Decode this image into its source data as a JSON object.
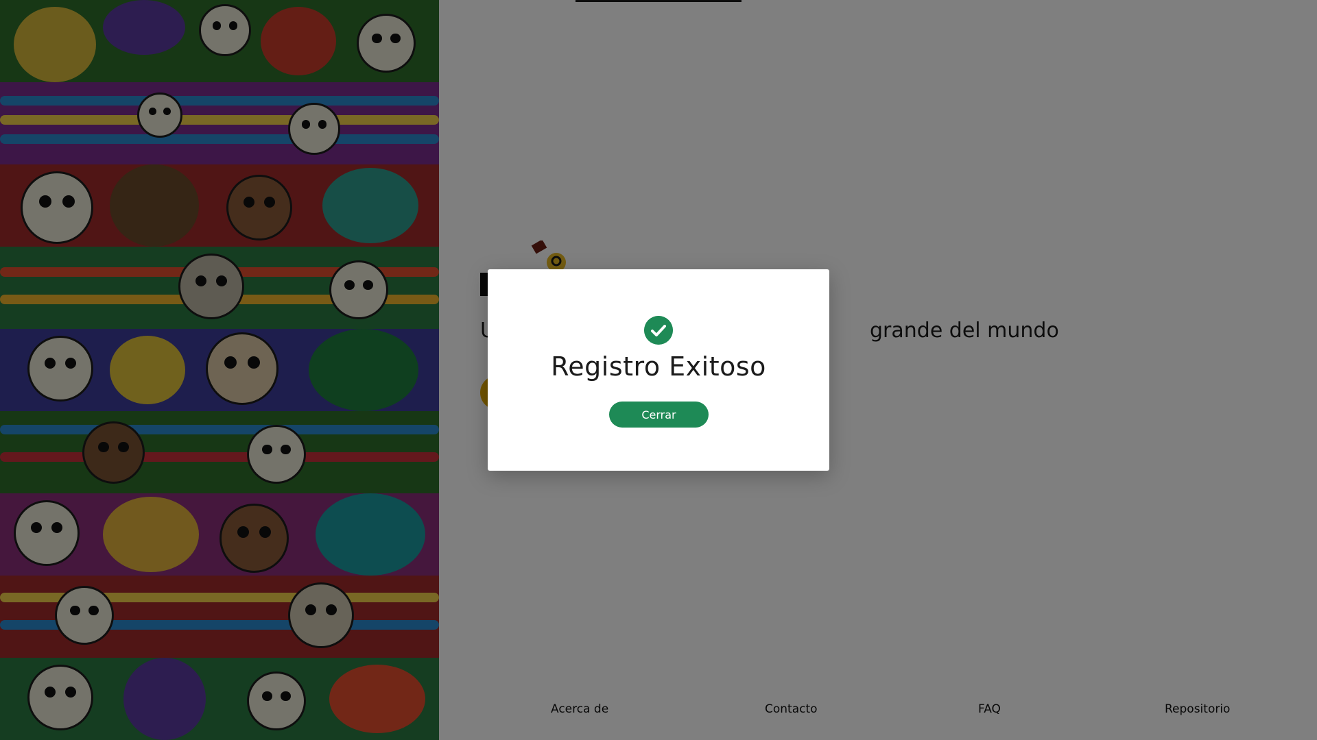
{
  "hero": {
    "subtitle_visible": "U",
    "subtitle_tail": "grande del mundo"
  },
  "modal": {
    "icon": "check-circle-icon",
    "title": "Registro Exitoso",
    "close_label": "Cerrar"
  },
  "footer": {
    "links": [
      "Acerca de",
      "Contacto",
      "FAQ",
      "Repositorio"
    ]
  },
  "colors": {
    "accent_green": "#1e8a56",
    "cta_yellow": "#e2a800",
    "overlay": "rgba(0,0,0,0.5)"
  }
}
